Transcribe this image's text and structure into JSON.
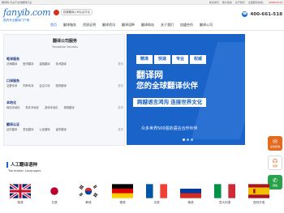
{
  "topbar": {
    "left_text": "翻译网-专业于全球翻译行业",
    "right_items": [
      "联系我们",
      "客户留言",
      "关于我们",
      "全国服务热线：",
      "400661518"
    ]
  },
  "logo": {
    "mark": "fanyib.com",
    "slogan": "国内专业翻译门户网"
  },
  "badge": {
    "text": "权威翻译公司认证平台"
  },
  "phone": {
    "icon": "phone-icon",
    "number": "400-661-518"
  },
  "nav": {
    "items": [
      "首页",
      "翻译服务",
      "资质证明",
      "翻译资讯",
      "翻译语种",
      "翻译网站",
      "关于我们",
      "加盟合作",
      "翻译公司"
    ]
  },
  "sidebar": {
    "title": "翻译公司服务",
    "subtitle": "Translation Services",
    "groups": [
      {
        "title": "笔译服务",
        "items": [
          "法律翻译",
          "医学翻译",
          "金融翻译",
          "技术翻译"
        ],
        "more": "更多"
      },
      {
        "title": "口译服务",
        "items": [
          "交替传译",
          "同声传译",
          "会议口译",
          "陪同翻译"
        ],
        "more": "更多"
      },
      {
        "title": "本地化",
        "items": [
          "网站本地化",
          "软件本地化",
          "游戏本地化",
          "视频翻译"
        ],
        "more": "更多"
      },
      {
        "title": "翻译认证",
        "items": [
          "证件翻译",
          "签证翻译",
          "公证翻译",
          "留学翻译"
        ],
        "more": "更多"
      }
    ]
  },
  "banner": {
    "chips": [
      "精准",
      "快速",
      "专业",
      "权威"
    ],
    "headline": "翻译网",
    "headline2": "您的全球翻译伙伴",
    "ribbon": "跨越语言鸿沟 连接世界文化",
    "footer": "众多世界500强的语言合作伙伴"
  },
  "float_rail": [
    {
      "icon": "chat-icon",
      "label": "在线咨询"
    },
    {
      "icon": "headset-icon",
      "label": "客服"
    },
    {
      "icon": "wechat-icon",
      "label": "微信"
    }
  ],
  "languages_section": {
    "title": "人工翻译语种",
    "subtitle": "Translation Languages",
    "languages": [
      {
        "name": "英语",
        "flag": "uk-flag-icon"
      },
      {
        "name": "日语",
        "flag": "japan-flag-icon"
      },
      {
        "name": "韩语",
        "flag": "korea-flag-icon"
      },
      {
        "name": "德语",
        "flag": "germany-flag-icon"
      },
      {
        "name": "法语",
        "flag": "france-flag-icon"
      },
      {
        "name": "俄语",
        "flag": "russia-flag-icon"
      },
      {
        "name": "意大利语",
        "flag": "italy-flag-icon"
      },
      {
        "name": "西班牙语",
        "flag": "spain-flag-icon"
      }
    ]
  },
  "colors": {
    "brand_blue": "#1a63c9",
    "accent_orange": "#e36b1f",
    "hot_red": "#e0312e"
  }
}
